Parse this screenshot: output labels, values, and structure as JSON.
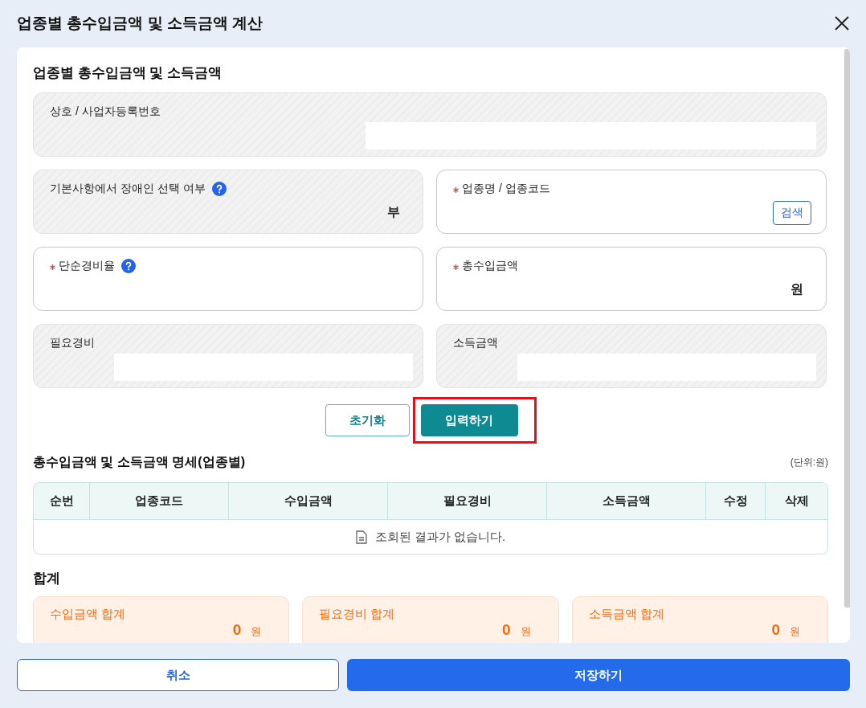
{
  "dialog": {
    "title": "업종별 총수입금액 및 소득금액 계산"
  },
  "section_title": "업종별 총수입금액 및 소득금액",
  "fields": [
    {
      "label": "상호 / 사업자등록번호",
      "required": false,
      "help": false,
      "readonly": true
    },
    {
      "label": "기본사항에서 장애인 선택 여부",
      "required": false,
      "help": true,
      "readonly": true,
      "value": "부"
    },
    {
      "label": "업종명 / 업종코드",
      "required": true,
      "help": false,
      "readonly": false,
      "action": "검색"
    },
    {
      "label": "단순경비율",
      "required": true,
      "help": true,
      "readonly": false
    },
    {
      "label": "총수입금액",
      "required": true,
      "help": false,
      "readonly": false,
      "unit": "원"
    },
    {
      "label": "필요경비",
      "required": false,
      "help": false,
      "readonly": true
    },
    {
      "label": "소득금액",
      "required": false,
      "help": false,
      "readonly": true
    }
  ],
  "actions": [
    {
      "label": "초기화",
      "kind": "outline",
      "highlighted": false
    },
    {
      "label": "입력하기",
      "kind": "primary",
      "highlighted": true
    }
  ],
  "table": {
    "title": "총수입금액 및 소득금액 명세(업종별)",
    "unit_note": "(단위:원)",
    "columns": [
      "순번",
      "업종코드",
      "수입금액",
      "필요경비",
      "소득금액",
      "수정",
      "삭제"
    ],
    "empty_message": "조회된 결과가 없습니다."
  },
  "totals": {
    "title": "합계",
    "cards": [
      {
        "label": "수입금액 합계",
        "value": "0",
        "unit": "원"
      },
      {
        "label": "필요경비 합계",
        "value": "0",
        "unit": "원"
      },
      {
        "label": "소득금액 합계",
        "value": "0",
        "unit": "원"
      }
    ]
  },
  "footer": [
    {
      "label": "취소",
      "kind": "outline"
    },
    {
      "label": "저장하기",
      "kind": "primary"
    }
  ]
}
